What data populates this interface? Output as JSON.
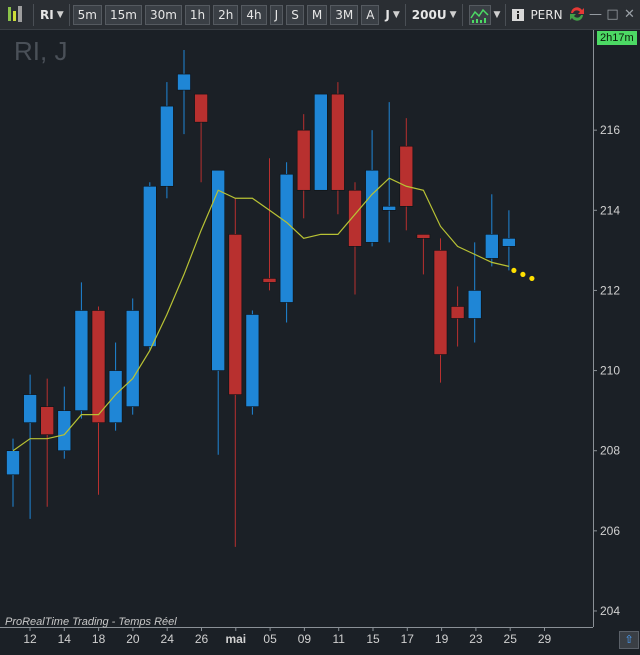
{
  "toolbar": {
    "symbol": "RI",
    "timeframes": [
      "5m",
      "15m",
      "30m",
      "1h",
      "2h",
      "4h",
      "J",
      "S",
      "M",
      "3M",
      "A"
    ],
    "selected_period": "J",
    "units": "200U",
    "instrument": "PERNOD"
  },
  "chart_title": "RI, J",
  "countdown": "2h17m",
  "footer": "ProRealTime Trading - Temps Réel",
  "colors": {
    "background": "#1b2026",
    "up": "#1f86d6",
    "down": "#b8302f",
    "wick": "#9aa3ad",
    "ma": "#b8c234",
    "projection": "#ffe000",
    "axis_text": "#d0d0d0"
  },
  "icons": [
    "candlestick-icon",
    "chevron-down-icon",
    "indicator-chart-icon",
    "info-icon",
    "sync-arrows-icon",
    "minimize-icon",
    "maximize-icon",
    "close-icon",
    "scroll-up-icon"
  ],
  "chart_data": {
    "type": "candlestick",
    "title": "RI, J",
    "ylim": [
      203.6,
      218.5
    ],
    "y_ticks": [
      204,
      206,
      208,
      210,
      212,
      214,
      216
    ],
    "x_tick_labels": [
      "12",
      "14",
      "18",
      "20",
      "24",
      "26",
      "mai",
      "05",
      "09",
      "11",
      "15",
      "17",
      "19",
      "23",
      "25",
      "29"
    ],
    "grid": false,
    "candles": [
      {
        "o": 207.4,
        "h": 208.3,
        "l": 206.6,
        "c": 208.0
      },
      {
        "o": 208.7,
        "h": 209.9,
        "l": 206.3,
        "c": 209.4
      },
      {
        "o": 209.1,
        "h": 209.8,
        "l": 206.6,
        "c": 208.4
      },
      {
        "o": 208.0,
        "h": 209.6,
        "l": 207.8,
        "c": 209.0
      },
      {
        "o": 209.0,
        "h": 212.2,
        "l": 208.8,
        "c": 211.5
      },
      {
        "o": 211.5,
        "h": 211.6,
        "l": 206.9,
        "c": 208.7
      },
      {
        "o": 208.7,
        "h": 210.7,
        "l": 208.5,
        "c": 210.0
      },
      {
        "o": 209.1,
        "h": 211.8,
        "l": 208.9,
        "c": 211.5
      },
      {
        "o": 210.6,
        "h": 214.7,
        "l": 210.5,
        "c": 214.6
      },
      {
        "o": 214.6,
        "h": 217.2,
        "l": 214.3,
        "c": 216.6
      },
      {
        "o": 217.0,
        "h": 218.0,
        "l": 215.9,
        "c": 217.4
      },
      {
        "o": 216.9,
        "h": 216.9,
        "l": 214.7,
        "c": 216.2
      },
      {
        "o": 210.0,
        "h": 215.0,
        "l": 207.9,
        "c": 215.0
      },
      {
        "o": 213.4,
        "h": 214.3,
        "l": 205.6,
        "c": 209.4
      },
      {
        "o": 209.1,
        "h": 211.5,
        "l": 208.9,
        "c": 211.4
      },
      {
        "o": 212.3,
        "h": 215.3,
        "l": 212.0,
        "c": 212.2
      },
      {
        "o": 211.7,
        "h": 215.2,
        "l": 211.2,
        "c": 214.9
      },
      {
        "o": 216.0,
        "h": 216.4,
        "l": 213.8,
        "c": 214.5
      },
      {
        "o": 214.5,
        "h": 216.9,
        "l": 214.5,
        "c": 216.9
      },
      {
        "o": 216.9,
        "h": 217.2,
        "l": 213.9,
        "c": 214.5
      },
      {
        "o": 214.5,
        "h": 214.7,
        "l": 211.9,
        "c": 213.1
      },
      {
        "o": 213.2,
        "h": 216.0,
        "l": 213.1,
        "c": 215.0
      },
      {
        "o": 214.0,
        "h": 216.7,
        "l": 213.2,
        "c": 214.1
      },
      {
        "o": 215.6,
        "h": 216.3,
        "l": 213.5,
        "c": 214.1
      },
      {
        "o": 213.4,
        "h": 213.4,
        "l": 212.4,
        "c": 213.3
      },
      {
        "o": 213.0,
        "h": 213.3,
        "l": 209.7,
        "c": 210.4
      },
      {
        "o": 211.6,
        "h": 212.1,
        "l": 210.6,
        "c": 211.3
      },
      {
        "o": 211.3,
        "h": 213.2,
        "l": 210.7,
        "c": 212.0
      },
      {
        "o": 212.8,
        "h": 214.4,
        "l": 212.6,
        "c": 213.4
      },
      {
        "o": 213.1,
        "h": 214.0,
        "l": 212.5,
        "c": 213.3
      }
    ],
    "moving_average": [
      208.0,
      208.3,
      208.3,
      208.4,
      208.9,
      208.9,
      209.4,
      209.8,
      210.5,
      211.4,
      212.4,
      213.5,
      214.5,
      214.3,
      214.3,
      214.0,
      213.7,
      213.3,
      213.4,
      213.4,
      213.9,
      214.4,
      214.8,
      214.6,
      214.5,
      213.6,
      213.1,
      212.9,
      212.7,
      212.6
    ],
    "projection": [
      212.5,
      212.4,
      212.3
    ]
  }
}
